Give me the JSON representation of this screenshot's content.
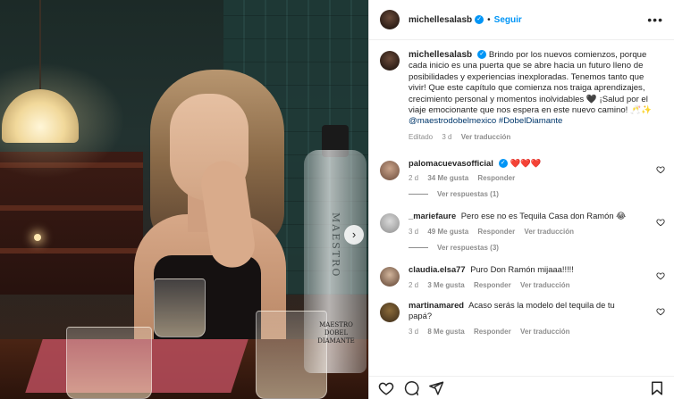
{
  "post": {
    "image": {
      "next_icon": "chevron-right-icon",
      "bottle_brand": "MAESTRO",
      "bottle_label": "MAESTRO DOBEL DIAMANTE"
    },
    "author": {
      "username": "michellesalasb",
      "verified": true,
      "separator": "•",
      "follow_label": "Seguir",
      "more_label": "•••"
    },
    "caption": {
      "username": "michellesalasb",
      "text": "Brindo por los nuevos comienzos, porque cada inicio es una puerta que se abre hacia un futuro lleno de posibilidades y experiencias inexploradas. Tenemos tanto que vivir! Que este capítulo que comienza nos traiga aprendizajes, crecimiento personal y momentos inolvidables 🖤 ¡Salud por el viaje emocionante que nos espera en este nuevo camino! 🥂✨",
      "hashtags": "@maestrodobelmexico #DobelDiamante",
      "meta": {
        "status": "Editado",
        "time": "3 d",
        "translate": "Ver traducción"
      }
    },
    "comments": [
      {
        "username": "palomacuevasofficial",
        "verified": true,
        "text": "❤️❤️❤️",
        "time": "2 d",
        "likes": "34 Me gusta",
        "reply": "Responder",
        "translate": "",
        "replies_label": "Ver respuestas (1)"
      },
      {
        "username": "_mariefaure",
        "verified": false,
        "text": "Pero ese no es Tequila Casa don Ramón 😂",
        "time": "3 d",
        "likes": "49 Me gusta",
        "reply": "Responder",
        "translate": "Ver traducción",
        "replies_label": "Ver respuestas (3)"
      },
      {
        "username": "claudia.elsa77",
        "verified": false,
        "text": "Puro Don Ramón mijaaa!!!!!",
        "time": "2 d",
        "likes": "3 Me gusta",
        "reply": "Responder",
        "translate": "Ver traducción",
        "replies_label": ""
      },
      {
        "username": "martinamared",
        "verified": false,
        "text": "Acaso serás la modelo del tequila de tu papá?",
        "time": "3 d",
        "likes": "8 Me gusta",
        "reply": "Responder",
        "translate": "Ver traducción",
        "replies_label": ""
      }
    ],
    "actions": {
      "like_icon": "heart-icon",
      "comment_icon": "comment-icon",
      "share_icon": "send-icon",
      "save_icon": "bookmark-icon"
    },
    "colors": {
      "accent": "#0095f6",
      "hashtag": "#00376b",
      "muted": "#8e8e8e",
      "text": "#262626"
    }
  }
}
